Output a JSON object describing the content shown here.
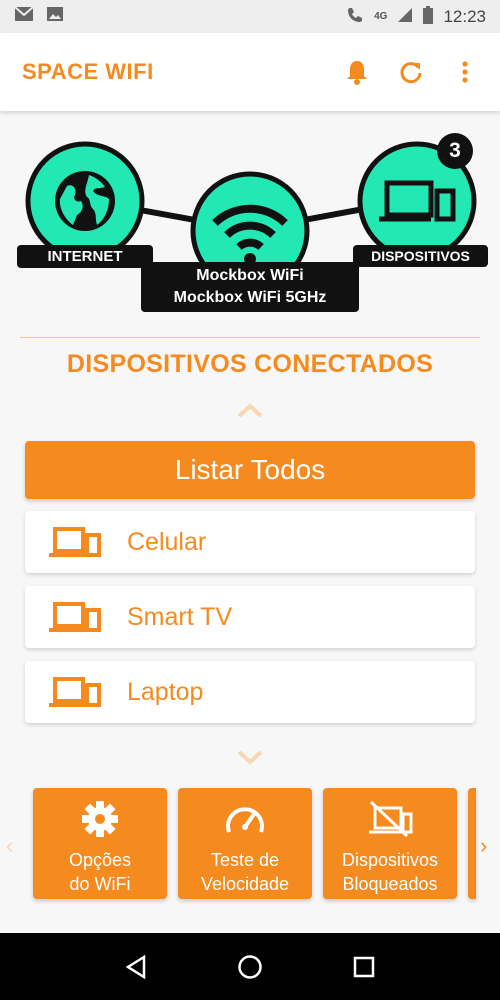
{
  "status_bar": {
    "time": "12:23",
    "network": "4G"
  },
  "app_bar": {
    "title": "SPACE WIFI"
  },
  "diagram": {
    "internet_label": "INTERNET",
    "devices_label": "DISPOSITIVOS",
    "devices_count": "3",
    "networks": [
      "Mockbox WiFi",
      "Mockbox WiFi 5GHz"
    ]
  },
  "section": {
    "title": "DISPOSITIVOS CONECTADOS"
  },
  "list_all_label": "Listar Todos",
  "devices": [
    "Celular",
    "Smart TV",
    "Laptop"
  ],
  "tiles": [
    {
      "line1": "Opções",
      "line2": "do WiFi",
      "icon": "gear-icon"
    },
    {
      "line1": "Teste de",
      "line2": "Velocidade",
      "icon": "speedometer-icon"
    },
    {
      "line1": "Dispositivos",
      "line2": "Bloqueados",
      "icon": "blocked-device-icon"
    }
  ],
  "colors": {
    "accent": "#f58a1f",
    "node_fill": "#22e8b4",
    "dark": "#111111"
  }
}
